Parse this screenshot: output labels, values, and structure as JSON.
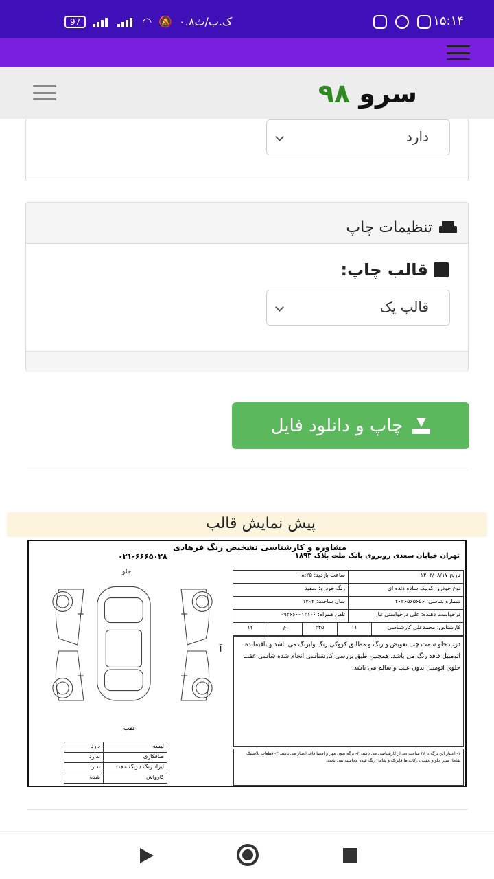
{
  "status_bar": {
    "time": "۱۵:۱۴",
    "network_speed": "۰.۸ک.ب/ث",
    "battery": "97"
  },
  "header": {
    "logo_text": "سرو",
    "logo_number": "۹۸"
  },
  "top_card": {
    "select_value": "دارد"
  },
  "print_settings": {
    "title": "تنظیمات چاپ",
    "template_label": "قالب چاپ:",
    "template_value": "قالب یک"
  },
  "download_button": {
    "label": "چاپ و دانلود فایل"
  },
  "preview": {
    "title": "پیش نمایش قالب",
    "form_title": "مشاوره و کارشناسی تشخیص رنگ فرهادی",
    "address": "تهران خیابان سعدی روبروی بانک ملت پلاک ۱۸۹۳",
    "phone": "۰۲۱-۶۶۶۵۰۲۸",
    "rows": [
      [
        "تاریخ ۱۴۰۳/۰۸/۱۷",
        "ساعت بازدید: ۰۸:۲۵"
      ],
      [
        "نوع خودرو: کوییک ساده دنده ای",
        "رنگ خودرو: سفید"
      ],
      [
        "شماره شاسی: ۲۰۳۶۵۶۵۶۵۶",
        "سال ساخت: ۱۴۰۲"
      ],
      [
        "درخواست دهنده: علی درخواستی تبار",
        "تلفن همراه: ۰۹۳۶۶۰۰۱۲۱۰۰"
      ]
    ],
    "expert": "کارشناس: محمدعلی کارشناسی",
    "plate": [
      "۱۱",
      "۳۴۵",
      "ع",
      "۱۲"
    ],
    "description": "درب جلو سمت چپ تعویض و رنگ و مطابق کروکی رنگ وابرنگ می باشد و باقیمانده اتومبیل فاقد رنگ می باشد. همچنین طبق بررسی کارشناسی انجام شده شاسی عقب جلوی اتومبیل بدون عیب و سالم می باشد.",
    "note": "۱- اعتبار این برگه تا ۲۸ ساعت بعد از کارشناسی می باشد. ۲- برگه بدون مهر و امضا فاقد اعتبار می باشد. ۳- قطعات پلاستیک شامل سپر جلو و عقب ، رکاب ها فابریک و شامل رنگ شده محاسبه نمی باشد.",
    "car_front_label": "جلو",
    "car_rear_label": "عقب",
    "side_label_right": "آ",
    "legend": [
      [
        "لیسه",
        "دارد"
      ],
      [
        "صافکاری",
        "ندارد"
      ],
      [
        "ایراد رنگ / رنگ مجدد",
        "ندارد"
      ],
      [
        "کارواش",
        "شده"
      ]
    ]
  }
}
